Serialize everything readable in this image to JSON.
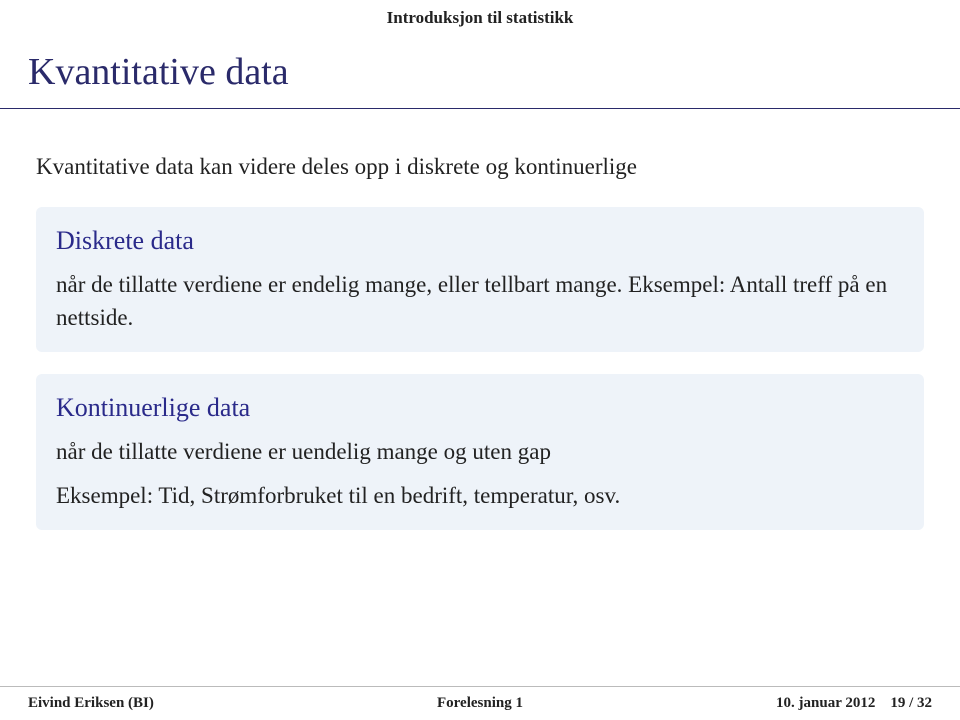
{
  "header": "Introduksjon til statistikk",
  "title": "Kvantitative data",
  "intro": "Kvantitative data kan videre deles opp i diskrete og kontinuerlige",
  "block1": {
    "title": "Diskrete data",
    "body": "når de tillatte verdiene er endelig mange, eller tellbart mange. Eksempel: Antall treff på en nettside."
  },
  "block2": {
    "title": "Kontinuerlige data",
    "body": "når de tillatte verdiene er uendelig mange og uten gap",
    "example": "Eksempel: Tid, Strømforbruket til en bedrift, temperatur, osv."
  },
  "footer": {
    "left": "Eivind Eriksen (BI)",
    "center": "Forelesning 1",
    "right": "10. januar 2012    19 / 32"
  }
}
